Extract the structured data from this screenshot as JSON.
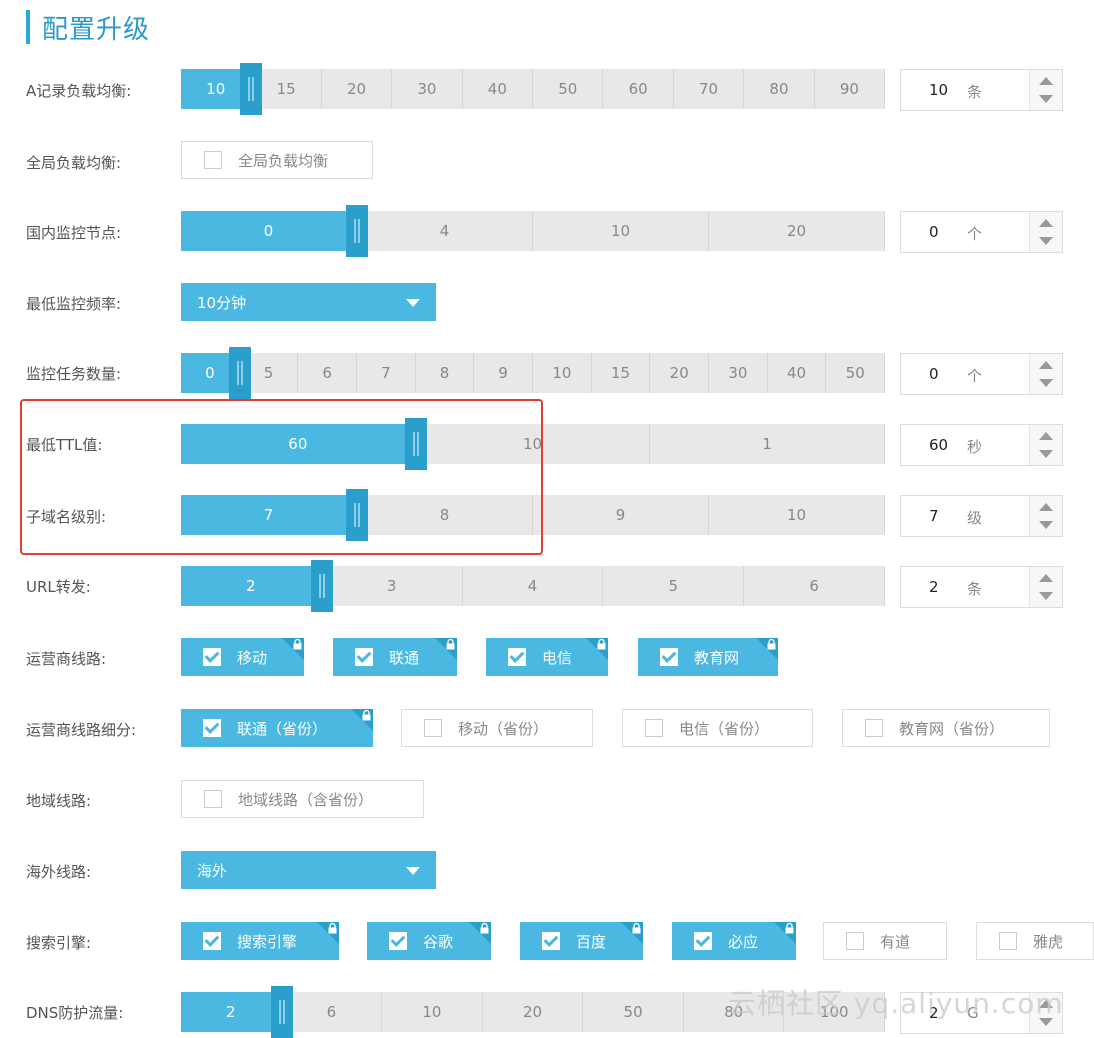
{
  "title": "配置升级",
  "rows": {
    "a_record": {
      "label": "A记录负载均衡:",
      "options": [
        "10",
        "15",
        "20",
        "30",
        "40",
        "50",
        "60",
        "70",
        "80",
        "90"
      ],
      "selected": "10",
      "value": "10",
      "unit": "条"
    },
    "global_lb": {
      "label": "全局负载均衡:",
      "checkbox": "全局负载均衡"
    },
    "domestic_nodes": {
      "label": "国内监控节点:",
      "options": [
        "0",
        "4",
        "10",
        "20"
      ],
      "selected": "0",
      "value": "0",
      "unit": "个"
    },
    "min_freq": {
      "label": "最低监控频率:",
      "selected": "10分钟"
    },
    "task_count": {
      "label": "监控任务数量:",
      "options": [
        "0",
        "5",
        "6",
        "7",
        "8",
        "9",
        "10",
        "15",
        "20",
        "30",
        "40",
        "50"
      ],
      "selected": "0",
      "value": "0",
      "unit": "个"
    },
    "min_ttl": {
      "label": "最低TTL值:",
      "options": [
        "60",
        "10",
        "1"
      ],
      "selected": "60",
      "value": "60",
      "unit": "秒"
    },
    "subdomain": {
      "label": "子域名级别:",
      "options": [
        "7",
        "8",
        "9",
        "10"
      ],
      "selected": "7",
      "value": "7",
      "unit": "级"
    },
    "url_forward": {
      "label": "URL转发:",
      "options": [
        "2",
        "3",
        "4",
        "5",
        "6"
      ],
      "selected": "2",
      "value": "2",
      "unit": "条"
    },
    "isp_lines": {
      "label": "运营商线路:",
      "items": [
        "移动",
        "联通",
        "电信",
        "教育网"
      ]
    },
    "isp_sub": {
      "label": "运营商线路细分:",
      "checked": "联通（省份）",
      "unchecked": [
        "移动（省份）",
        "电信（省份）",
        "教育网（省份）"
      ]
    },
    "region": {
      "label": "地域线路:",
      "checkbox": "地域线路（含省份）"
    },
    "overseas": {
      "label": "海外线路:",
      "selected": "海外"
    },
    "search": {
      "label": "搜索引擎:",
      "checked": [
        "搜索引擎",
        "谷歌",
        "百度",
        "必应"
      ],
      "unchecked": [
        "有道",
        "雅虎"
      ]
    },
    "dns_protect": {
      "label": "DNS防护流量:",
      "options": [
        "2",
        "6",
        "10",
        "20",
        "50",
        "80",
        "100"
      ],
      "selected": "2",
      "value": "2",
      "unit": "G"
    }
  },
  "watermark": "云栖社区 yq.aliyun.com",
  "colors": {
    "accent": "#4ab8e0",
    "handle": "#2a9fcc",
    "highlight_border": "#e53c35"
  }
}
